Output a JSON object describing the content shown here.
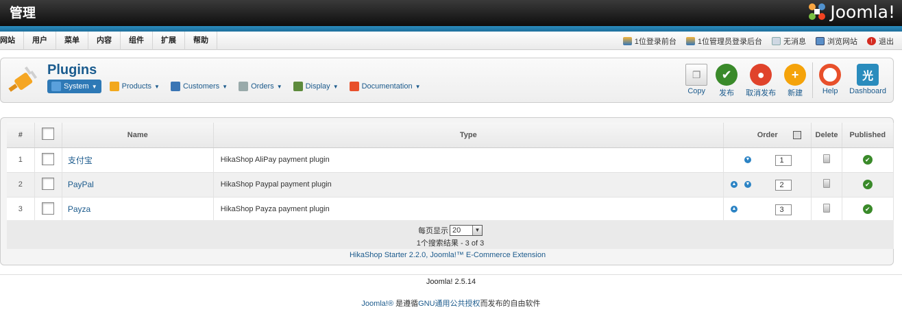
{
  "header": {
    "title": "管理",
    "logo_text": "Joomla!"
  },
  "menu": [
    "网站",
    "用户",
    "菜单",
    "内容",
    "组件",
    "扩展",
    "帮助"
  ],
  "status": {
    "frontend_users": "1位登录前台",
    "admin_users": "1位管理员登录后台",
    "messages": "无消息",
    "view_site": "浏览网站",
    "logout": "退出"
  },
  "toolbar": {
    "page_title": "Plugins",
    "submenu": [
      {
        "label": "System",
        "icon": "wand-icon",
        "active": true
      },
      {
        "label": "Products",
        "icon": "box-icon",
        "active": false
      },
      {
        "label": "Customers",
        "icon": "users-icon",
        "active": false
      },
      {
        "label": "Orders",
        "icon": "orders-icon",
        "active": false
      },
      {
        "label": "Display",
        "icon": "display-icon",
        "active": false
      },
      {
        "label": "Documentation",
        "icon": "lifebuoy-icon",
        "active": false
      }
    ],
    "actions": {
      "copy": "Copy",
      "publish": "发布",
      "unpublish": "取消发布",
      "new": "新建",
      "help": "Help",
      "dashboard": "Dashboard"
    }
  },
  "table": {
    "headers": {
      "num": "#",
      "name": "Name",
      "type": "Type",
      "order": "Order",
      "delete": "Delete",
      "published": "Published"
    },
    "rows": [
      {
        "num": "1",
        "name": "支付宝",
        "type": "HikaShop AliPay payment plugin",
        "order": "1",
        "up": false,
        "down": true,
        "published": true
      },
      {
        "num": "2",
        "name": "PayPal",
        "type": "HikaShop Paypal payment plugin",
        "order": "2",
        "up": true,
        "down": true,
        "published": true
      },
      {
        "num": "3",
        "name": "Payza",
        "type": "HikaShop Payza payment plugin",
        "order": "3",
        "up": true,
        "down": false,
        "published": true
      }
    ]
  },
  "pagination": {
    "display_label": "每页显示",
    "limit": "20",
    "results": "1个搜索结果 - 3 of 3"
  },
  "credit": "HikaShop Starter 2.2.0, Joomla!™ E-Commerce Extension",
  "footer": {
    "version": "Joomla! 2.5.14",
    "license_link1": "Joomla!®",
    "license_text1": " 是遵循",
    "license_link2": "GNU通用公共授权",
    "license_text2": "而发布的自由软件"
  },
  "colors": {
    "accent": "#1b5a8c",
    "blue_bar": "#2a8cbd",
    "publish_green": "#3a8a2a",
    "unpublish_red": "#e0432b",
    "new_orange": "#f5a30a"
  }
}
